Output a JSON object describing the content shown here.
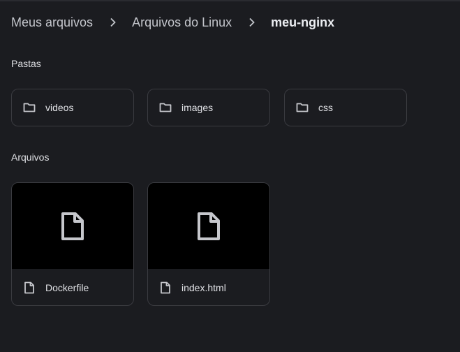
{
  "breadcrumb": {
    "items": [
      "Meus arquivos",
      "Arquivos do Linux",
      "meu-nginx"
    ]
  },
  "sections": {
    "folders_label": "Pastas",
    "files_label": "Arquivos"
  },
  "folders": [
    {
      "name": "videos",
      "icon": "folder-icon"
    },
    {
      "name": "images",
      "icon": "folder-icon"
    },
    {
      "name": "css",
      "icon": "folder-icon"
    }
  ],
  "files": [
    {
      "name": "Dockerfile",
      "icon": "file-icon"
    },
    {
      "name": "index.html",
      "icon": "file-icon"
    }
  ],
  "colors": {
    "background": "#1b1c20",
    "tile_border": "#3a3b40",
    "preview_background": "#000000",
    "icon": "#c6c7cc"
  }
}
